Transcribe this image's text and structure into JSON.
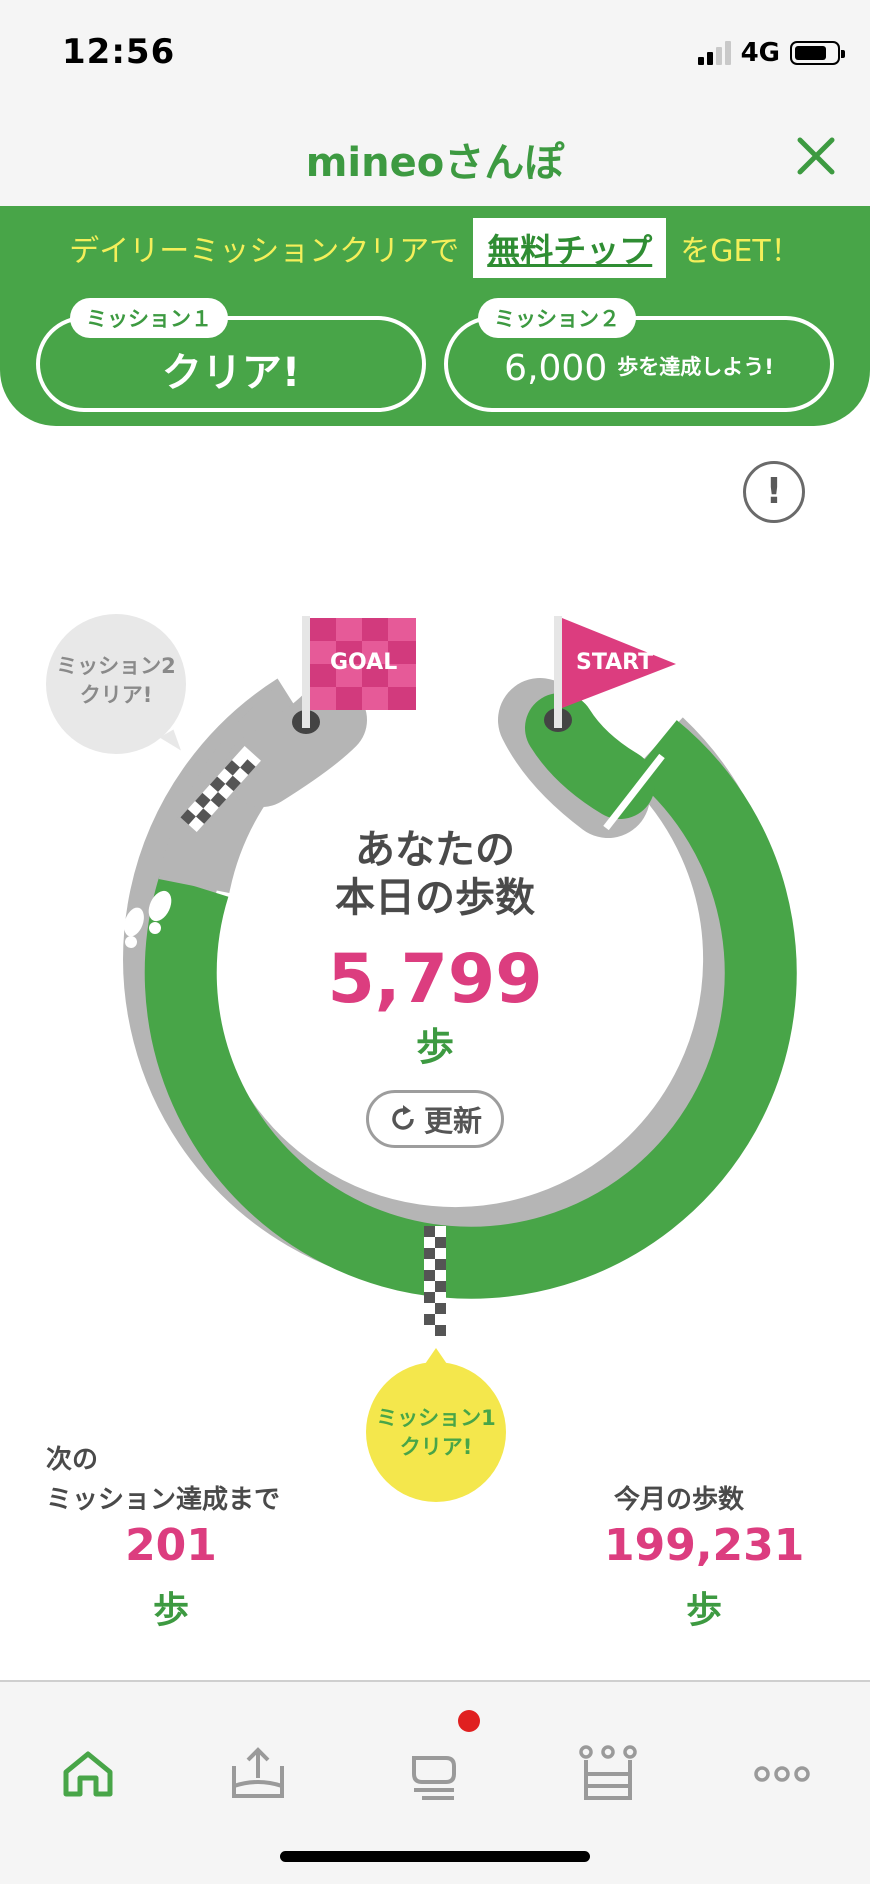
{
  "status": {
    "time": "12:56",
    "network": "4G",
    "battery_level": 0.78
  },
  "header": {
    "title": "mineoさんぽ"
  },
  "banner": {
    "text_before": "デイリーミッションクリアで",
    "chip": "無料チップ",
    "text_after": "をGET！",
    "mission1": {
      "tag": "ミッション１",
      "status": "クリア!"
    },
    "mission2": {
      "tag": "ミッション２",
      "goal_number": "6,000",
      "goal_text": "歩を達成しよう!"
    }
  },
  "course": {
    "goal_flag": "GOAL",
    "start_flag": "START",
    "bubble_mission2": [
      "ミッション2",
      "クリア!"
    ],
    "bubble_mission1": [
      "ミッション1",
      "クリア!"
    ],
    "center_label_line1": "あなたの",
    "center_label_line2": "本日の歩数",
    "steps_today": "5,799",
    "steps_unit": "歩",
    "refresh_label": "更新"
  },
  "stats": {
    "next_mission_label_line1": "次の",
    "next_mission_label_line2": "ミッション達成まで",
    "next_mission_value": "201",
    "next_mission_unit": "歩",
    "month_label": "今月の歩数",
    "month_value": "199,231",
    "month_unit": "歩"
  },
  "tabs": [
    {
      "name": "home",
      "icon": "home-icon",
      "active": true
    },
    {
      "name": "upload",
      "icon": "upload-tray-icon",
      "active": false
    },
    {
      "name": "chat",
      "icon": "chat-bubble-icon",
      "active": false,
      "badge": true
    },
    {
      "name": "ranking",
      "icon": "crown-icon",
      "active": false
    },
    {
      "name": "more",
      "icon": "more-dots-icon",
      "active": false
    }
  ],
  "colors": {
    "brand_green": "#48a548",
    "accent_pink": "#dc3d7f",
    "yellow": "#f4e74c",
    "gray_track": "#b5b5b5"
  }
}
